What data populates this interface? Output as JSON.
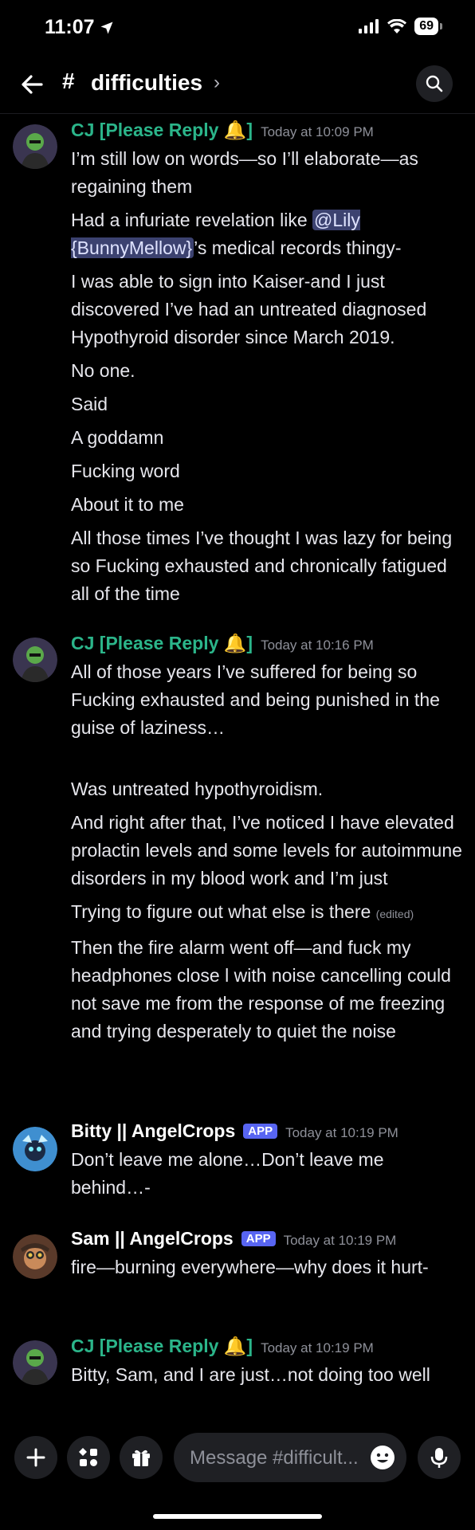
{
  "status_bar": {
    "time": "11:07",
    "battery": "69"
  },
  "header": {
    "hash_symbol": "#",
    "channel_name": "difficulties",
    "chevron": "›"
  },
  "messages": [
    {
      "author": "CJ [Please Reply 🔔]",
      "timestamp": "Today at 10:09 PM",
      "lines": [
        "I’m still low on words—so I’ll elaborate—as regaining them",
        "I was able to sign into Kaiser-and I just discovered I’ve had an untreated diagnosed Hypothyroid disorder since March 2019.",
        "No one.",
        "Said",
        "A goddamn",
        "Fucking word",
        "About it to me",
        "All those times I’ve thought I was lazy for being so Fucking exhausted and chronically fatigued all of the time"
      ],
      "mention_line": {
        "before": "Had a infuriate revelation like ",
        "mention": "@Lily {BunnyMellow}",
        "after": "’s medical records thingy-"
      }
    },
    {
      "author": "CJ [Please Reply 🔔]",
      "timestamp": "Today at 10:16 PM",
      "lines": [
        "All of those years I’ve suffered for being so Fucking exhausted and being punished in the guise of laziness…",
        "Was untreated hypothyroidism.",
        "And right after that, I’ve noticed I have elevated prolactin levels and some levels for autoimmune disorders in my blood work and I’m just",
        "Trying to figure out what else is there",
        "Then the fire alarm went off—and fuck my headphones close l with noise cancelling could not save me from the response of me freezing and trying desperately to quiet the noise"
      ],
      "edited_label": "(edited)"
    },
    {
      "author": "Bitty || AngelCrops",
      "tag": "APP",
      "timestamp": "Today at 10:19 PM",
      "lines": [
        "Don’t leave me alone…Don’t leave me behind…-"
      ]
    },
    {
      "author": "Sam || AngelCrops",
      "tag": "APP",
      "timestamp": "Today at 10:19 PM",
      "lines": [
        "fire—burning everywhere—why does it hurt-"
      ]
    },
    {
      "author": "CJ [Please Reply 🔔]",
      "timestamp": "Today at 10:19 PM",
      "lines": [
        "Bitty, Sam, and I are just…not doing too well"
      ]
    }
  ],
  "composer": {
    "placeholder": "Message #difficult..."
  },
  "colors": {
    "background": "#000000",
    "cj_name": "#2bb58a",
    "app_tag": "#5865f2",
    "mention_bg": "#3c4270",
    "muted": "#8e9099"
  },
  "icons": [
    "location-arrow-icon",
    "signal-icon",
    "wifi-icon",
    "back-arrow-icon",
    "search-icon",
    "plus-icon",
    "apps-icon",
    "gift-icon",
    "emoji-icon",
    "microphone-icon"
  ]
}
